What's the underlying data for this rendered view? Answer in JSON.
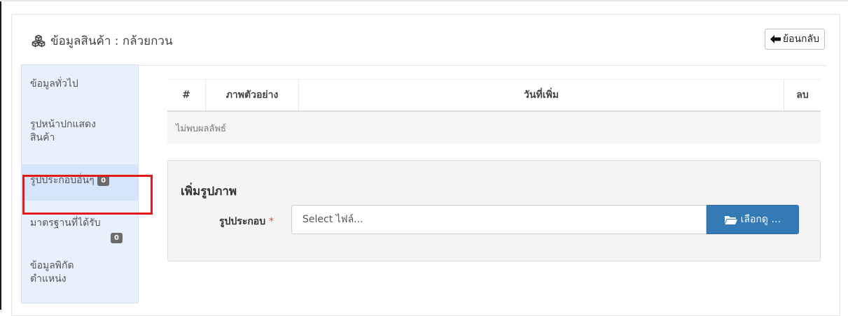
{
  "header": {
    "icon": "cubes-icon",
    "title": "ข้อมูลสินค้า : กล้วยกวน",
    "back_button": {
      "icon": "arrow-left-icon",
      "label": "ย้อนกลับ"
    }
  },
  "sidebar": {
    "items": [
      {
        "label": "ข้อมูลทั่วไป",
        "badge": null
      },
      {
        "label": "รูปหน้าปกแสดง สินค้า",
        "badge": null
      },
      {
        "label": "รูปประกอบอื่นๆ",
        "badge": "0",
        "active": true
      },
      {
        "label": "มาตรฐานที่ได้รับ",
        "badge": "0"
      },
      {
        "label": "ข้อมูลพิกัด ตำแหน่ง",
        "badge": null
      }
    ]
  },
  "table": {
    "columns": [
      "#",
      "ภาพตัวอย่าง",
      "วันที่เพิ่ม",
      "ลบ"
    ],
    "empty_message": "ไม่พบผลลัพธ์"
  },
  "add_image": {
    "title": "เพิ่มรูปภาพ",
    "field_label": "รูปประกอบ",
    "required_mark": "*",
    "file_placeholder": "Select ไฟล์...",
    "browse_button": {
      "icon": "folder-open-icon",
      "label": "เลือกดู …"
    }
  },
  "colors": {
    "accent": "#337ab7",
    "highlight": "#e01b1b",
    "sidebar_bg": "#e8f0fb"
  }
}
